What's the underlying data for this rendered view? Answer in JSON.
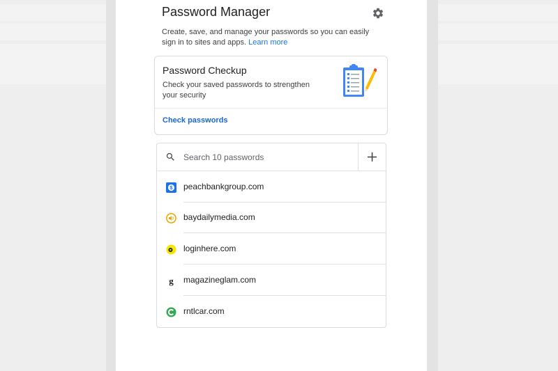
{
  "header": {
    "title": "Password Manager",
    "settings_icon": "gear-icon",
    "description": "Create, save, and manage your passwords so you can easily sign in to sites and apps.",
    "learn_more": "Learn more"
  },
  "checkup": {
    "title": "Password Checkup",
    "description": "Check your saved passwords to strengthen your security",
    "illustration": "clipboard-checklist-illustration",
    "action": "Check passwords"
  },
  "search": {
    "placeholder": "Search 10 passwords",
    "add_icon": "plus-icon"
  },
  "passwords": [
    {
      "site": "peachbankgroup.com",
      "icon": "dollar-favicon"
    },
    {
      "site": "baydailymedia.com",
      "icon": "speaker-favicon"
    },
    {
      "site": "loginhere.com",
      "icon": "login-favicon"
    },
    {
      "site": "magazineglam.com",
      "icon": "g-letter-favicon"
    },
    {
      "site": "rntlcar.com",
      "icon": "c-letter-favicon"
    }
  ],
  "colors": {
    "accent": "#1a73e8",
    "link": "#1967d2",
    "border": "#dadce0",
    "background": "#e9e9e9"
  }
}
